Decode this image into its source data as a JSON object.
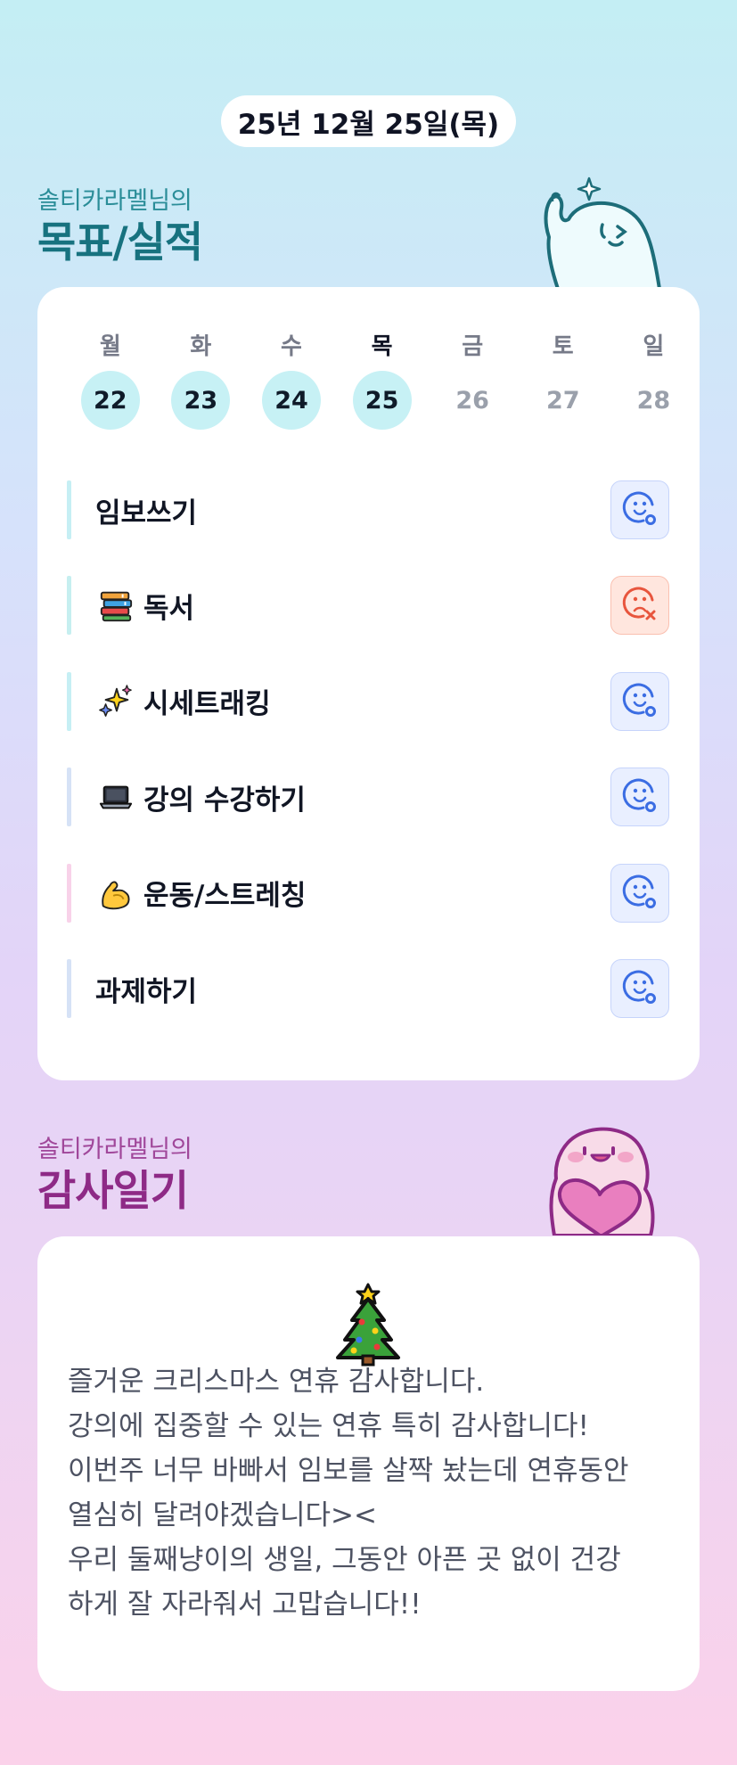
{
  "date": "25년 12월 25일(목)",
  "goals_section": {
    "subtitle": "솔티카라멜님의",
    "title": "목표/실적"
  },
  "week": [
    {
      "label": "월",
      "day": "22",
      "done": true,
      "today": false
    },
    {
      "label": "화",
      "day": "23",
      "done": true,
      "today": false
    },
    {
      "label": "수",
      "day": "24",
      "done": true,
      "today": false
    },
    {
      "label": "목",
      "day": "25",
      "done": true,
      "today": true
    },
    {
      "label": "금",
      "day": "26",
      "done": false,
      "today": false
    },
    {
      "label": "토",
      "day": "27",
      "done": false,
      "today": false
    },
    {
      "label": "일",
      "day": "28",
      "done": false,
      "today": false
    }
  ],
  "goals": [
    {
      "label": "임보쓰기",
      "emoji": "",
      "bar_color": "#c6eff4",
      "status": "success"
    },
    {
      "label": "독서",
      "emoji": "books-icon",
      "bar_color": "#c6eff0",
      "status": "fail"
    },
    {
      "label": "시세트래킹",
      "emoji": "sparkles-icon",
      "bar_color": "#c6eff4",
      "status": "success"
    },
    {
      "label": "강의 수강하기",
      "emoji": "laptop-icon",
      "bar_color": "#d6e2f6",
      "status": "success"
    },
    {
      "label": "운동/스트레칭",
      "emoji": "flexed-biceps-icon",
      "bar_color": "#f8d2e9",
      "status": "success"
    },
    {
      "label": "과제하기",
      "emoji": "",
      "bar_color": "#d6e2f6",
      "status": "success"
    }
  ],
  "gratitude_section": {
    "subtitle": "솔티카라멜님의",
    "title": "감사일기"
  },
  "gratitude": {
    "emoji": "christmas-tree-icon",
    "lines": [
      "즐거운 크리스마스 연휴 감사합니다.",
      "강의에 집중할 수 있는 연휴 특히 감사합니다!",
      "이번주 너무 바빠서 임보를 살짝 놨는데 연휴동안",
      "열심히 달려야겠습니다><",
      "우리 둘째냥이의 생일, 그동안 아픈 곳 없이 건강",
      "하게 잘 자라줘서 고맙습니다!!"
    ]
  },
  "colors": {
    "success": "#3b6de3",
    "fail": "#e8553d",
    "goal_title": "#17727f",
    "gratitude_title": "#8e2a86"
  }
}
